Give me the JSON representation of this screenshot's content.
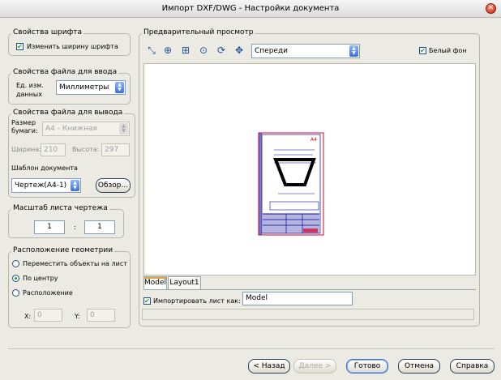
{
  "window": {
    "title": "Импорт DXF/DWG - Настройки документа",
    "close_glyph": "●"
  },
  "font_props": {
    "title": "Свойства шрифта",
    "change_width_label": "Изменить ширину шрифта",
    "change_width_checked": true
  },
  "input_props": {
    "title": "Свойства файла для ввода",
    "unit_label_1": "Ед. изм.",
    "unit_label_2": "данных",
    "unit_value": "Миллиметры"
  },
  "output_props": {
    "title": "Свойства файла для вывода",
    "paper_label_1": "Размер",
    "paper_label_2": "бумаги:",
    "paper_value": "A4 - Книжная",
    "width_label": "Ширина:",
    "width_value": "210",
    "height_label": "Высота:",
    "height_value": "297",
    "template_label": "Шаблон документа",
    "template_value": "Чертеж(A4-1)",
    "browse_label": "Обзор..."
  },
  "scale": {
    "title": "Масштаб листа чертежа",
    "left": "1",
    "sep": ":",
    "right": "1"
  },
  "geometry": {
    "title": "Расположение геометрии",
    "options": [
      {
        "label": "Переместить объекты на лист",
        "selected": false
      },
      {
        "label": "По центру",
        "selected": true
      },
      {
        "label": "Расположение",
        "selected": false
      }
    ],
    "x_label": "X:",
    "x_value": "0",
    "y_label": "Y:",
    "y_value": "0"
  },
  "preview": {
    "title": "Предварительный просмотр",
    "view_value": "Спереди",
    "white_bg_label": "Белый фон",
    "white_bg_checked": true,
    "tools": [
      {
        "icon": "pointer-icon",
        "glyph": "⤡"
      },
      {
        "icon": "zoom-in-icon",
        "glyph": "⊕"
      },
      {
        "icon": "zoom-window-icon",
        "glyph": "⊞"
      },
      {
        "icon": "zoom-extents-icon",
        "glyph": "⊙"
      },
      {
        "icon": "rotate-icon",
        "glyph": "⟳"
      },
      {
        "icon": "pan-icon",
        "glyph": "✥"
      }
    ],
    "drawing_mark": "A4"
  },
  "layout": {
    "tabs": [
      "Model",
      "Layout1"
    ],
    "active_tab": 0,
    "import_sheet_label": "Импортировать лист как:",
    "import_sheet_checked": true,
    "import_sheet_value": "Model"
  },
  "buttons": {
    "back": "< Назад",
    "next": "Далее >",
    "finish": "Готово",
    "cancel": "Отмена",
    "help": "Справка"
  },
  "colors": {
    "accent": "#3a6ec8",
    "drawing_border": "#d8002a",
    "drawing_ink": "#0a0a99"
  }
}
